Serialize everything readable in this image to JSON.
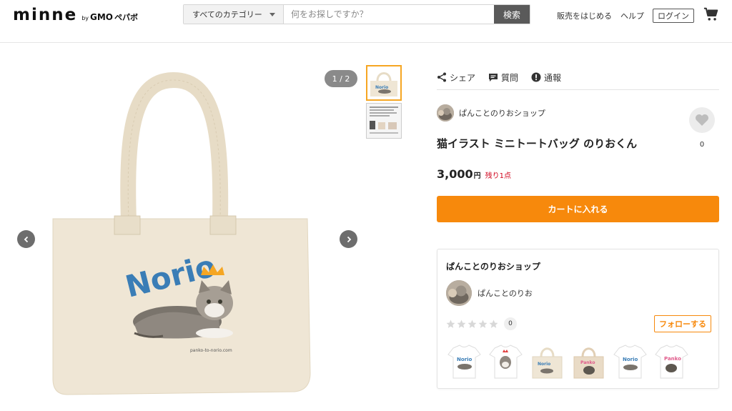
{
  "header": {
    "logo": {
      "main": "minne",
      "by": "by",
      "gmo": "GMO",
      "pepabo": "ペパボ"
    },
    "search": {
      "category_label": "すべてのカテゴリー",
      "placeholder": "何をお探しですか？",
      "button_label": "検索"
    },
    "links": {
      "sell": "販売をはじめる",
      "help": "ヘルプ",
      "login": "ログイン"
    }
  },
  "gallery": {
    "counter": "1 / 2",
    "thumbnail_count": 2,
    "print_text": "Norio",
    "print_url": "panko-to-norio.com"
  },
  "product": {
    "actions": {
      "share": "シェア",
      "question": "質問",
      "report": "通報"
    },
    "shop_name": "ぱんことのりおショップ",
    "favorite_count": "0",
    "title": "猫イラスト ミニトートバッグ のりおくん",
    "price": "3,000",
    "currency": "円",
    "stock_text": "残り1点",
    "cart_button": "カートに入れる"
  },
  "shop_card": {
    "title": "ぱんことのりおショップ",
    "owner_name": "ぱんことのりお",
    "rating_count": "0",
    "follow_button": "フォローする",
    "item_count": 6
  },
  "colors": {
    "accent_orange": "#f7890c",
    "stock_red": "#d0021b",
    "thumb_active": "#f6a623",
    "search_button": "#5a5a5a"
  }
}
